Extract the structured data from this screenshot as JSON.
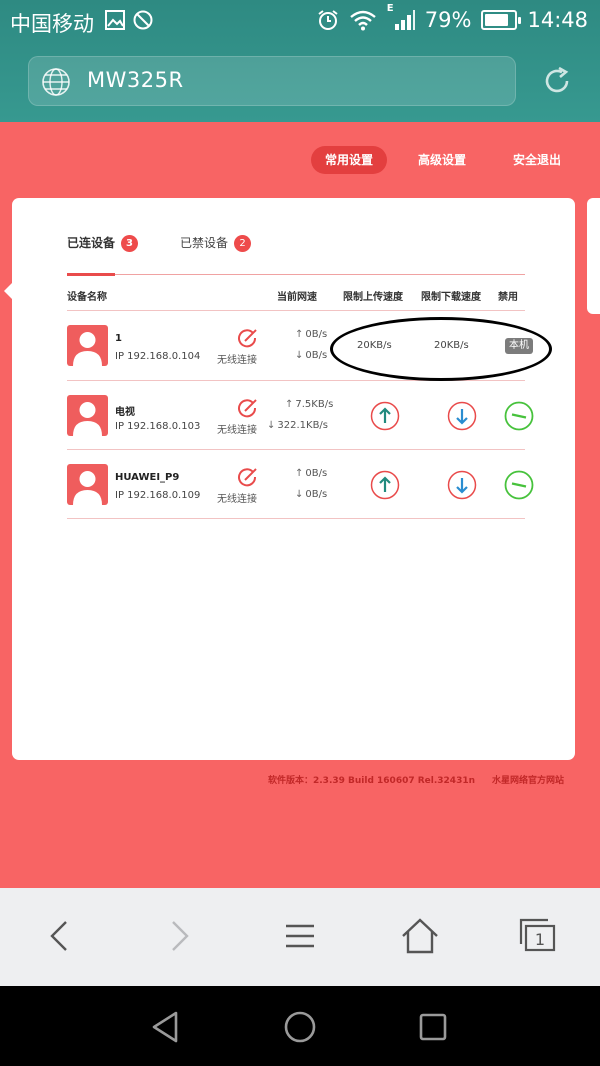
{
  "status_bar": {
    "carrier": "中国移动",
    "network": "E",
    "battery": "79%",
    "battery_level": 0.79,
    "time": "14:48"
  },
  "browser": {
    "url": "MW325R"
  },
  "nav": {
    "common": "常用设置",
    "advanced": "高级设置",
    "logout": "安全退出"
  },
  "tabs": [
    {
      "label": "已连设备",
      "count": "3"
    },
    {
      "label": "已禁设备",
      "count": "2"
    }
  ],
  "columns": {
    "name": "设备名称",
    "speed": "当前网速",
    "up_limit": "限制上传速度",
    "down_limit": "限制下载速度",
    "ban": "禁用"
  },
  "devices": [
    {
      "name": "1",
      "ip": "IP 192.168.0.104",
      "conn": "无线连接",
      "up": "0B/s",
      "down": "0B/s",
      "up_limit": "20KB/s",
      "down_limit": "20KB/s",
      "local": "本机"
    },
    {
      "name": "电视",
      "ip": "IP 192.168.0.103",
      "conn": "无线连接",
      "up": "7.5KB/s",
      "down": "322.1KB/s"
    },
    {
      "name": "HUAWEI_P9",
      "ip": "IP 192.168.0.109",
      "conn": "无线连接",
      "up": "0B/s",
      "down": "0B/s"
    }
  ],
  "footer": {
    "version": "软件版本：2.3.39 Build 160607 Rel.32431n",
    "site": "水星网络官方网站"
  },
  "colors": {
    "brand_red": "#f86464",
    "teal": "#379990",
    "accent_red": "#e94b4b"
  }
}
